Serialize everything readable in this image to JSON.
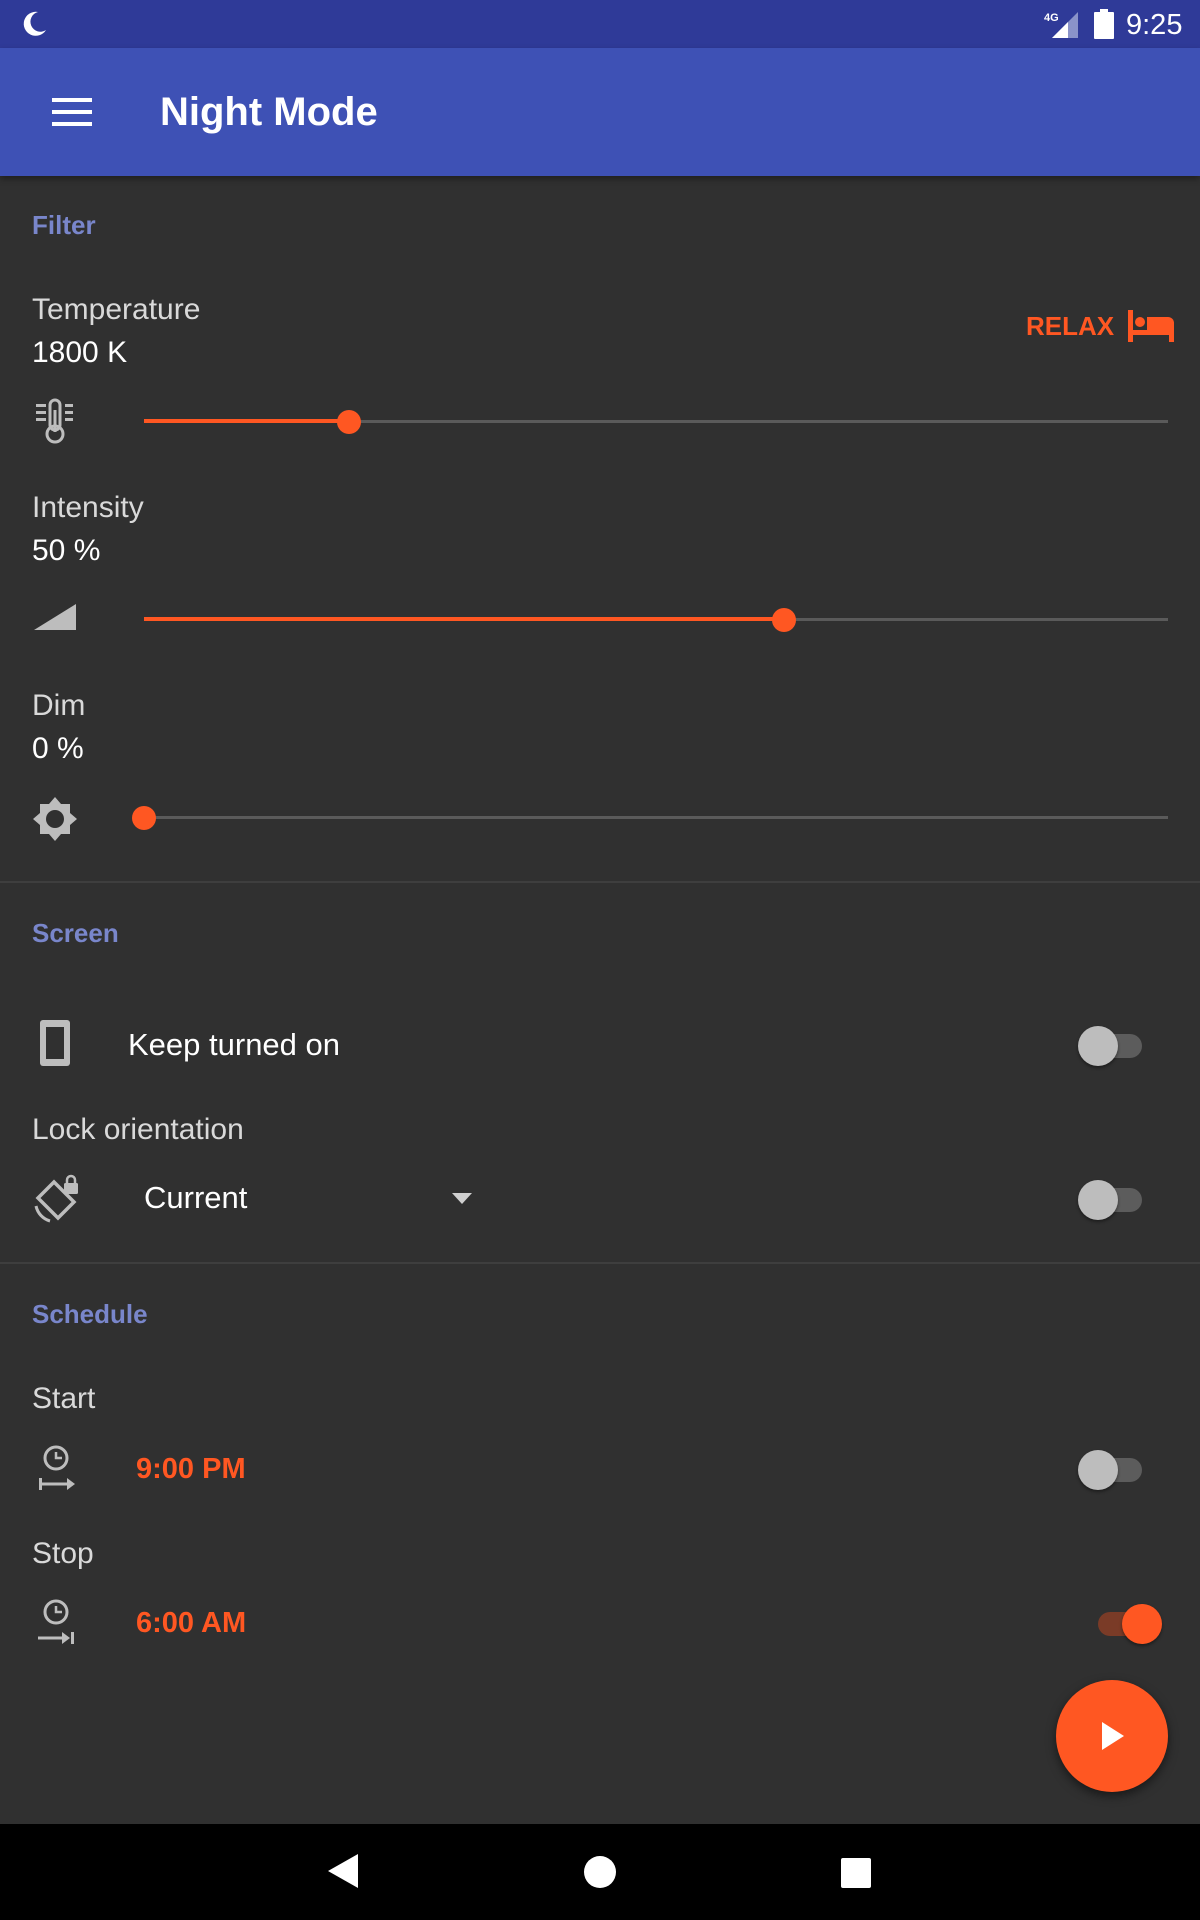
{
  "status_bar": {
    "network": "4G",
    "time": "9:25",
    "icons": [
      "moon-icon",
      "signal-icon",
      "battery-icon"
    ]
  },
  "app_bar": {
    "title": "Night Mode",
    "menu_icon": "hamburger-menu-icon"
  },
  "filter": {
    "section_title": "Filter",
    "temperature": {
      "label": "Temperature",
      "value": "1800 K",
      "slider_fraction": 0.2,
      "icon": "thermometer-icon"
    },
    "relax": {
      "label": "RELAX",
      "icon": "bed-icon"
    },
    "intensity": {
      "label": "Intensity",
      "value": "50 %",
      "slider_fraction": 0.625,
      "icon": "intensity-wedge-icon"
    },
    "dim": {
      "label": "Dim",
      "value": "0 %",
      "slider_fraction": 0.0,
      "icon": "brightness-icon"
    }
  },
  "screen": {
    "section_title": "Screen",
    "keep_on": {
      "label": "Keep turned on",
      "checked": false,
      "icon": "phone-icon"
    },
    "lock_orientation": {
      "label": "Lock orientation",
      "selected": "Current",
      "checked": false,
      "icon": "screen-lock-rotation-icon"
    }
  },
  "schedule": {
    "section_title": "Schedule",
    "start": {
      "label": "Start",
      "time": "9:00 PM",
      "checked": false,
      "icon": "clock-start-icon"
    },
    "stop": {
      "label": "Stop",
      "time": "6:00 AM",
      "checked": true,
      "icon": "clock-end-icon"
    }
  },
  "fab": {
    "icon": "play-icon"
  },
  "nav": {
    "icons": [
      "back-icon",
      "home-icon",
      "recents-icon"
    ]
  },
  "colors": {
    "primary": "#3e51b5",
    "primary_dark": "#2f3a98",
    "accent": "#ff5722",
    "section": "#7986cb",
    "background": "#303030"
  }
}
